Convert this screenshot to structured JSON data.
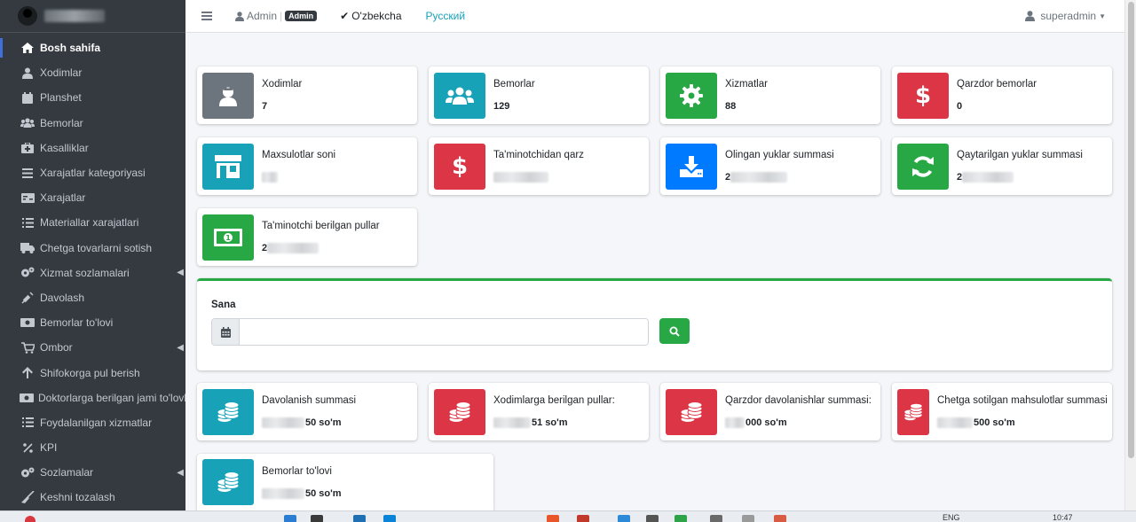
{
  "sidebar": {
    "items": [
      {
        "label": "Bosh sahifa",
        "icon": "home-icon",
        "active": true,
        "caret": false
      },
      {
        "label": "Xodimlar",
        "icon": "user-tie-icon",
        "caret": false
      },
      {
        "label": "Planshet",
        "icon": "calendar-icon",
        "caret": false
      },
      {
        "label": "Bemorlar",
        "icon": "users-icon",
        "caret": false
      },
      {
        "label": "Kasalliklar",
        "icon": "medkit-icon",
        "caret": false
      },
      {
        "label": "Xarajatlar kategoriyasi",
        "icon": "bars-icon",
        "caret": false
      },
      {
        "label": "Xarajatlar",
        "icon": "money-check-icon",
        "caret": false
      },
      {
        "label": "Materiallar xarajatlari",
        "icon": "list-icon",
        "caret": false
      },
      {
        "label": "Chetga tovarlarni sotish",
        "icon": "truck-icon",
        "caret": false
      },
      {
        "label": "Xizmat sozlamalari",
        "icon": "cogs-icon",
        "caret": true
      },
      {
        "label": "Davolash",
        "icon": "syringe-icon",
        "caret": false
      },
      {
        "label": "Bemorlar to'lovi",
        "icon": "money-bill-icon",
        "caret": false
      },
      {
        "label": "Ombor",
        "icon": "cart-icon",
        "caret": true
      },
      {
        "label": "Shifokorga pul berish",
        "icon": "arrow-up-icon",
        "caret": false
      },
      {
        "label": "Doktorlarga berilgan jami to'lovlar",
        "icon": "money-bill-icon",
        "caret": false
      },
      {
        "label": "Foydalanilgan xizmatlar",
        "icon": "list-icon",
        "caret": false
      },
      {
        "label": "KPI",
        "icon": "percent-icon",
        "caret": false
      },
      {
        "label": "Sozlamalar",
        "icon": "cogs-icon",
        "caret": true
      },
      {
        "label": "Keshni tozalash",
        "icon": "broom-icon",
        "caret": false
      }
    ]
  },
  "topbar": {
    "admin_label": "Admin",
    "admin_badge": "Admin",
    "lang_uz": "O'zbekcha",
    "lang_ru": "Русский",
    "user": "superadmin"
  },
  "stats": [
    {
      "label": "Xodimlar",
      "value": "7",
      "color": "#6c757d",
      "icon": "user-nurse-icon"
    },
    {
      "label": "Bemorlar",
      "value": "129",
      "color": "#17a2b8",
      "icon": "users-icon"
    },
    {
      "label": "Xizmatlar",
      "value": "88",
      "color": "#28a745",
      "icon": "gear-icon"
    },
    {
      "label": "Qarzdor bemorlar",
      "value": "0",
      "color": "#dc3545",
      "icon": "dollar-icon"
    },
    {
      "label": "Maxsulotlar soni",
      "value": "",
      "color": "#17a2b8",
      "icon": "store-icon"
    },
    {
      "label": "Ta'minotchidan qarz",
      "value": "",
      "color": "#dc3545",
      "icon": "dollar-icon"
    },
    {
      "label": "Olingan yuklar summasi",
      "value": "2",
      "color": "#007bff",
      "icon": "download-icon"
    },
    {
      "label": "Qaytarilgan yuklar summasi",
      "value": "2",
      "color": "#28a745",
      "icon": "sync-icon"
    },
    {
      "label": "Ta'minotchi berilgan pullar",
      "value": "2",
      "color": "#28a745",
      "icon": "money-bill-icon"
    }
  ],
  "search": {
    "label": "Sana",
    "placeholder": "",
    "value": ""
  },
  "sums": [
    {
      "label": "Davolanish summasi",
      "value": "50 so'm",
      "color": "#17a2b8",
      "icon": "coins-icon"
    },
    {
      "label": "Xodimlarga berilgan pullar:",
      "value": "51 so'm",
      "color": "#dc3545",
      "icon": "coins-icon"
    },
    {
      "label": "Qarzdor davolanishlar summasi:",
      "value": "000 so'm",
      "color": "#dc3545",
      "icon": "coins-icon"
    },
    {
      "label": "Chetga sotilgan mahsulotlar summasi",
      "value": "500 so'm",
      "color": "#dc3545",
      "icon": "coins-icon"
    },
    {
      "label": "Bemorlar to'lovi",
      "value": "50 so'm",
      "color": "#17a2b8",
      "icon": "coins-icon"
    }
  ],
  "taskbar": {
    "lang": "ENG",
    "time": "10:47"
  }
}
